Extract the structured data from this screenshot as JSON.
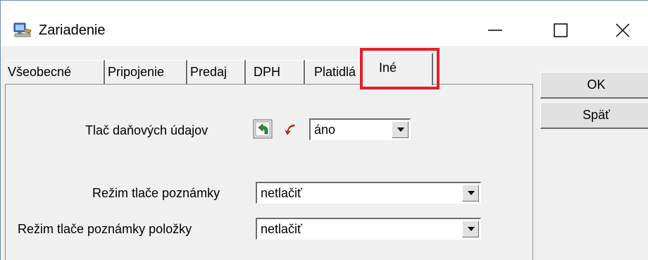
{
  "window": {
    "title": "Zariadenie",
    "controls": {
      "minimize": "—",
      "maximize": "☐",
      "close": "✕"
    }
  },
  "tabs": [
    {
      "label": "Všeobecné",
      "active": false
    },
    {
      "label": "Pripojenie",
      "active": false
    },
    {
      "label": "Predaj",
      "active": false
    },
    {
      "label": "DPH",
      "active": false
    },
    {
      "label": "Platidlá",
      "active": false
    },
    {
      "label": "Iné",
      "active": true
    }
  ],
  "buttons": {
    "ok": "OK",
    "back": "Späť"
  },
  "form": {
    "tax_print": {
      "label": "Tlač daňových údajov",
      "value": "áno"
    },
    "note_mode": {
      "label": "Režim tlače poznámky",
      "value": "netlačiť"
    },
    "item_note_mode": {
      "label": "Režim tlače poznámky položky",
      "value": "netlačiť"
    }
  },
  "colors": {
    "highlight": "#e51f2a",
    "panel": "#f0f0f0"
  }
}
